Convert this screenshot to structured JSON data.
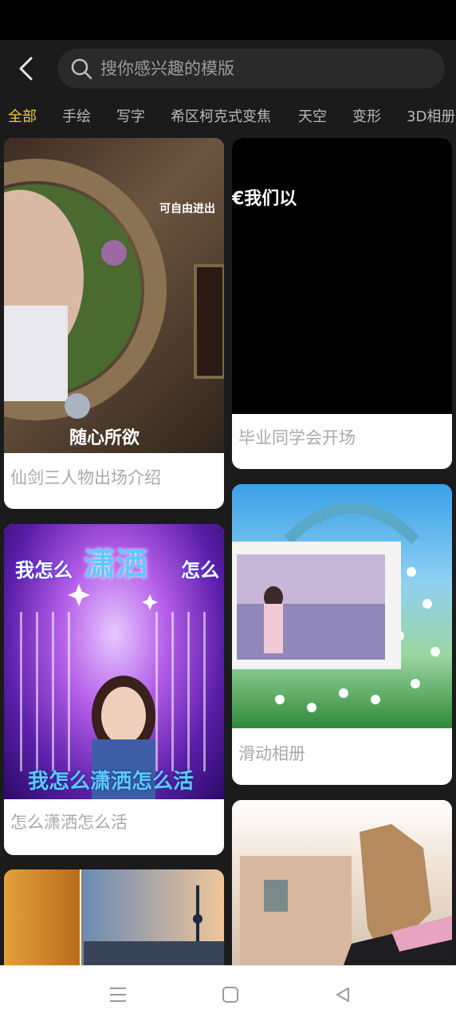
{
  "search": {
    "placeholder": "搜你感兴趣的模版"
  },
  "tabs": [
    "全部",
    "手绘",
    "写字",
    "希区柯克式变焦",
    "天空",
    "变形",
    "3D相册"
  ],
  "active_tab": "全部",
  "cards": [
    {
      "title": "仙剑三人物出场介绍",
      "overlay": "随心所欲",
      "overlay2": "可自由进出"
    },
    {
      "title": "毕业同学会开场",
      "overlay": "€我们以"
    },
    {
      "title": "怎么潇洒怎么活",
      "overlay_top_left": "我怎么",
      "overlay_top_big": "潇洒",
      "overlay_top_right": "怎么",
      "overlay_bottom": "我怎么潇洒怎么活"
    },
    {
      "title": "滑动相册"
    },
    {
      "title": ""
    },
    {
      "title": ""
    }
  ],
  "colors": {
    "accent": "#f3c540",
    "bg": "#1b1b1b",
    "card_title": "#a9a9a9"
  },
  "icons": {
    "back": "chevron-left-icon",
    "search": "search-icon",
    "nav_menu": "menu-icon",
    "nav_home": "home-square-icon",
    "nav_back": "back-triangle-icon"
  }
}
